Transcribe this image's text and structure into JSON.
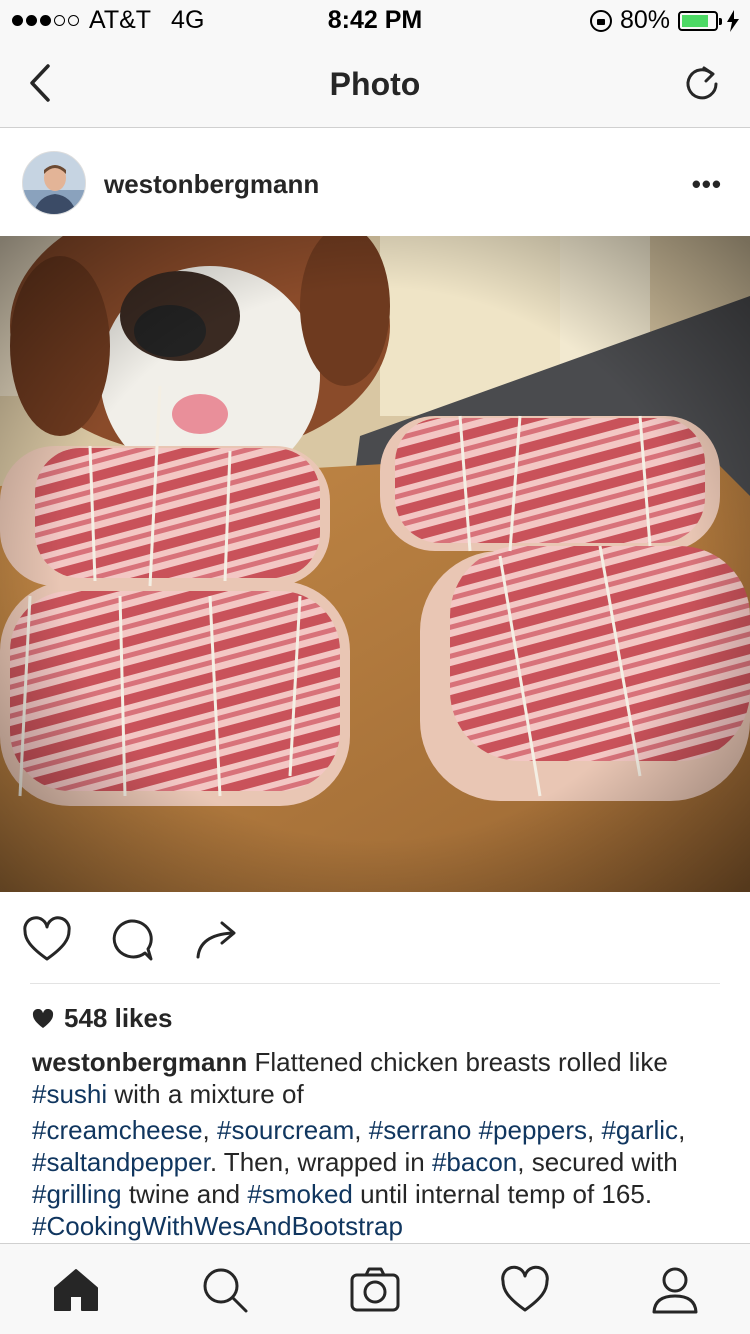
{
  "status_bar": {
    "carrier": "AT&T",
    "network": "4G",
    "time": "8:42 PM",
    "battery": "80%",
    "signal_full_dots": 3,
    "signal_total_dots": 5,
    "battery_level": 0.8
  },
  "nav": {
    "title": "Photo"
  },
  "post": {
    "username": "westonbergmann",
    "likes": "548 likes",
    "caption": {
      "username": "westonbergmann",
      "seg1": " Flattened chicken breasts rolled like ",
      "tag1": "#sushi",
      "seg2": " with a mixture of",
      "tag2": "#creamcheese",
      "seg3": ", ",
      "tag3": "#sourcream",
      "seg4": ", ",
      "tag4": "#serrano",
      "seg5": " ",
      "tag5": "#peppers",
      "seg6": ", ",
      "tag6": "#garlic",
      "seg7": ", ",
      "tag7": "#saltandpepper",
      "seg8": ". Then, wrapped in ",
      "tag8": "#bacon",
      "seg9": ", secured with ",
      "tag9": "#grilling",
      "seg10": " twine and ",
      "tag10": "#smoked",
      "seg11": " until internal temp of 165. ",
      "tag11": "#CookingWithWesAndBootstrap"
    }
  },
  "colors": {
    "hashtag": "#10365f",
    "text": "#262626",
    "bar_bg": "#f8f8f8",
    "battery_fill": "#4cd964"
  },
  "icons": {
    "nav": [
      "back-chevron-icon",
      "refresh-icon"
    ],
    "actions": [
      "heart-icon",
      "comment-icon",
      "share-icon"
    ],
    "tabs": [
      "home-icon",
      "search-icon",
      "camera-icon",
      "activity-heart-icon",
      "profile-icon"
    ]
  }
}
